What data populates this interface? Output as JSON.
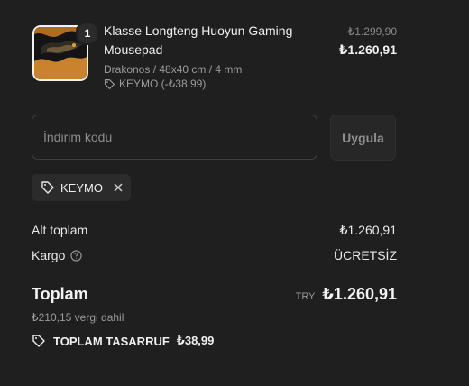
{
  "product": {
    "quantity": "1",
    "title": "Klasse Longteng Huoyun Gaming Mousepad",
    "variant": "Drakonos / 48x40 cm / 4 mm",
    "discount_text": "KEYMO (-₺38,99)",
    "original_price": "₺1.299,90",
    "price": "₺1.260,91"
  },
  "discount_code": {
    "placeholder": "İndirim kodu",
    "value": "",
    "apply_label": "Uygula",
    "applied_code": "KEYMO"
  },
  "summary": {
    "subtotal_label": "Alt toplam",
    "subtotal_value": "₺1.260,91",
    "shipping_label": "Kargo",
    "shipping_value": "ÜCRETSİZ",
    "total_label": "Toplam",
    "currency_code": "TRY",
    "total_value": "₺1.260,91",
    "tax_note": "₺210,15 vergi dahil",
    "savings_label": "TOPLAM TASARRUF",
    "savings_value": "₺38,99"
  },
  "icons": {
    "tag": "tag-icon",
    "close": "close-icon",
    "help": "question-circle-icon"
  },
  "colors": {
    "background": "#1f1f1f",
    "text": "#e9e9e9",
    "muted": "#9b9b9b",
    "chip_bg": "#2b2b2b"
  }
}
